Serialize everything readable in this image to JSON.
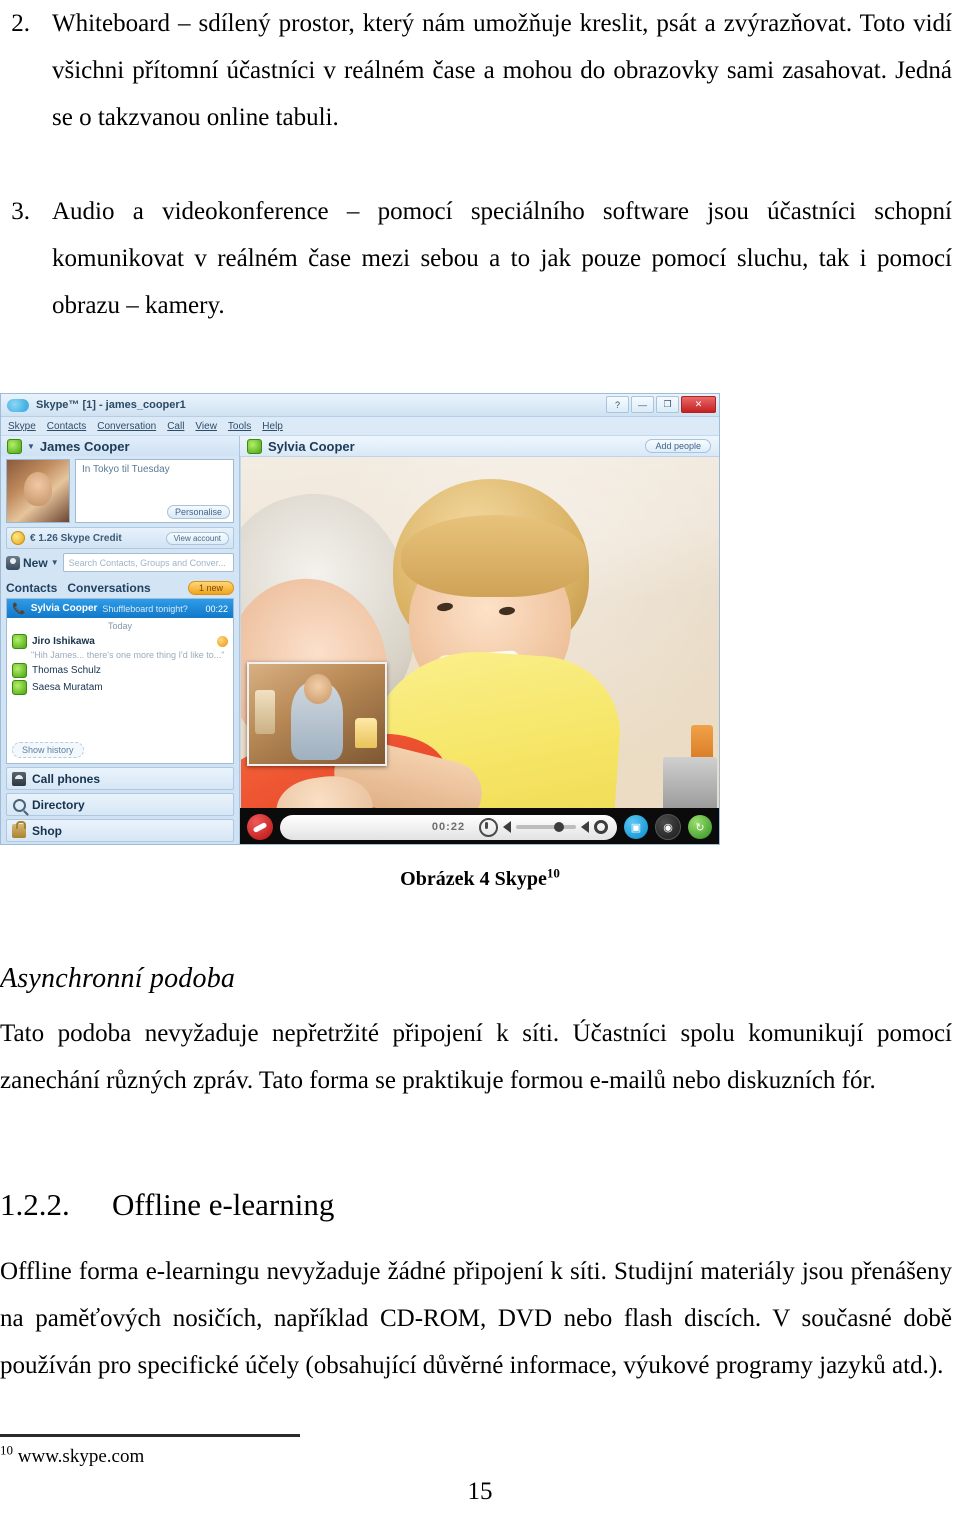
{
  "document": {
    "list_items": [
      {
        "number": "2.",
        "text": "Whiteboard – sdílený prostor, který nám umožňuje kreslit, psát a zvýrazňovat. Toto vidí všichni přítomní účastníci v reálném čase a mohou do obrazovky sami zasahovat. Jedná se o takzvanou online tabuli."
      },
      {
        "number": "3.",
        "text": "Audio a videokonference – pomocí speciálního software jsou účastníci schopní komunikovat v reálném čase mezi sebou a to jak pouze pomocí sluchu, tak i pomocí obrazu – kamery."
      }
    ],
    "figure_caption": {
      "text": "Obrázek 4 Skype",
      "footnote_marker": "10"
    },
    "section_asynchronous": {
      "heading": "Asynchronní podoba",
      "paragraph": "Tato podoba nevyžaduje nepřetržité připojení k síti. Účastníci spolu komunikují pomocí zanechání různých zpráv. Tato forma se praktikuje formou e-mailů nebo diskuzních fór."
    },
    "section_offline": {
      "number": "1.2.2.",
      "heading": "Offline e-learning",
      "paragraph": "Offline forma e-learningu nevyžaduje žádné připojení k síti. Studijní materiály jsou přenášeny na paměťových nosičích, například CD-ROM, DVD nebo flash discích. V současné době používán pro specifické účely (obsahující důvěrné informace, výukové programy jazyků atd.)."
    },
    "footnote": {
      "marker": "10",
      "text": "www.skype.com"
    },
    "page_number": "15"
  },
  "figure_skype": {
    "titlebar": {
      "title": "Skype™ [1] - james_cooper1",
      "controls": {
        "help": "?",
        "minimize": "—",
        "maximize": "❐",
        "close": "✕"
      }
    },
    "menubar": [
      "Skype",
      "Contacts",
      "Conversation",
      "Call",
      "View",
      "Tools",
      "Help"
    ],
    "profile": {
      "display_name": "James Cooper",
      "mood_message": "In Tokyo til Tuesday",
      "personalise_label": "Personalise",
      "credit_label": "€ 1.26 Skype Credit",
      "account_label": "View account"
    },
    "toolbar": {
      "new_label": "New",
      "search_placeholder": "Search Contacts, Groups and Conver..."
    },
    "tabs": {
      "contacts": "Contacts",
      "conversations": "Conversations",
      "badge": "1 new"
    },
    "conversation_selected": {
      "name": "Sylvia Cooper",
      "snippet": "Shuffleboard tonight?",
      "time": "00:22"
    },
    "day_label": "Today",
    "contacts": [
      {
        "name": "Jiro Ishikawa",
        "snippet": "\"Hih James... there's one more thing I'd like to...\"",
        "unread": true
      },
      {
        "name": "Thomas Schulz",
        "snippet": "",
        "unread": false
      },
      {
        "name": "Saesa Muratam",
        "snippet": "",
        "unread": false
      }
    ],
    "show_history_label": "Show history",
    "nav_items": [
      {
        "label": "Call phones",
        "icon": "phone-icon"
      },
      {
        "label": "Directory",
        "icon": "search-icon"
      },
      {
        "label": "Shop",
        "icon": "shop-icon"
      }
    ],
    "conversation_header": {
      "name": "Sylvia Cooper",
      "add_people_label": "Add people"
    },
    "call_controls": {
      "timer": "00:22",
      "hangup": "hangup-icon",
      "mute": "microphone-icon",
      "speaker": "speaker-icon",
      "settings": "gear-icon",
      "video": "video-icon",
      "chat": "chat-icon",
      "resume": "resume-icon"
    }
  },
  "colors": {
    "skype_blue": "#1278c8",
    "selected_row": "#2e9de8",
    "badge_orange": "#f0a41b",
    "close_red": "#c52020",
    "text_black": "#000000"
  }
}
